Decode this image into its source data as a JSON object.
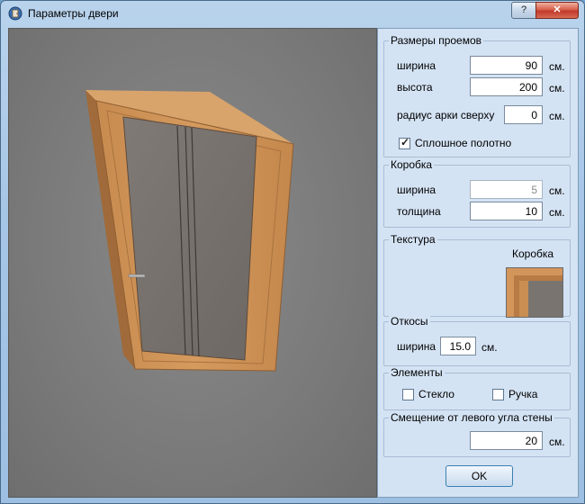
{
  "window": {
    "title": "Параметры двери",
    "help_label": "?",
    "close_label": "✕"
  },
  "openings": {
    "title": "Размеры проемов",
    "width_label": "ширина",
    "width_value": "90",
    "width_unit": "см.",
    "height_label": "высота",
    "height_value": "200",
    "height_unit": "см.",
    "arch_label": "радиус арки сверху",
    "arch_value": "0",
    "arch_unit": "см.",
    "solid_label": "Сплошное полотно",
    "solid_checked": true
  },
  "frame": {
    "title": "Коробка",
    "width_label": "ширина",
    "width_value": "5",
    "width_unit": "см.",
    "thickness_label": "толщина",
    "thickness_value": "10",
    "thickness_unit": "см."
  },
  "texture": {
    "title": "Текстура",
    "frame_label": "Коробка"
  },
  "slopes": {
    "title": "Откосы",
    "width_label": "ширина",
    "width_value": "15.0",
    "width_unit": "см."
  },
  "elements": {
    "title": "Элементы",
    "glass_label": "Стекло",
    "handle_label": "Ручка"
  },
  "offset": {
    "title": "Смещение от левого угла стены",
    "value": "20",
    "unit": "см."
  },
  "ok_label": "OK",
  "colors": {
    "wood": "#c98e52",
    "glass": "#7a7470",
    "viewport": "#7a7a7a",
    "panel": "#d4e3f4"
  }
}
